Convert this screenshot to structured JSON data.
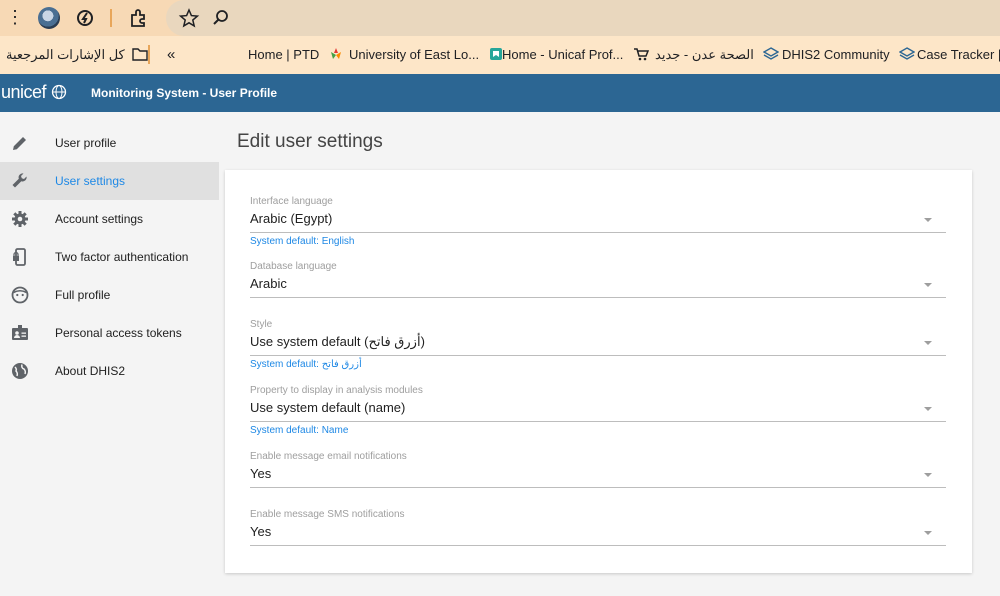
{
  "browser": {
    "bookmarks": [
      {
        "label": "كل الإشارات المرجعية",
        "icon": "folder-icon"
      },
      {
        "label": "Home | PTD",
        "icon": "ptd-icon"
      },
      {
        "label": "University of East Lo...",
        "icon": "university-icon"
      },
      {
        "label": "Home - Unicaf Prof...",
        "icon": "cart-icon"
      },
      {
        "label": "الصحة عدن - جديد",
        "icon": "dhis2-icon"
      },
      {
        "label": "DHIS2 Community",
        "icon": "dhis2-icon"
      },
      {
        "label": "Case Tracker | D",
        "icon": ""
      }
    ],
    "overflow_label": "«"
  },
  "app": {
    "logo": "unicef",
    "title": "Monitoring System - User Profile"
  },
  "sidebar": {
    "items": [
      {
        "label": "User profile",
        "icon": "pencil-icon",
        "active": false
      },
      {
        "label": "User settings",
        "icon": "wrench-icon",
        "active": true
      },
      {
        "label": "Account settings",
        "icon": "gear-icon",
        "active": false
      },
      {
        "label": "Two factor authentication",
        "icon": "phone-lock-icon",
        "active": false
      },
      {
        "label": "Full profile",
        "icon": "face-icon",
        "active": false
      },
      {
        "label": "Personal access tokens",
        "icon": "id-card-icon",
        "active": false
      },
      {
        "label": "About DHIS2",
        "icon": "globe-icon",
        "active": false
      }
    ]
  },
  "main": {
    "title": "Edit user settings",
    "fields": [
      {
        "label": "Interface language",
        "value": "Arabic (Egypt)",
        "help": "System default: English"
      },
      {
        "label": "Database language",
        "value": "Arabic",
        "help": ""
      },
      {
        "label": "Style",
        "value": "Use system default (أزرق فاتح)",
        "help": "System default: أزرق فاتح"
      },
      {
        "label": "Property to display in analysis modules",
        "value": "Use system default (name)",
        "help": "System default: Name"
      },
      {
        "label": "Enable message email notifications",
        "value": "Yes",
        "help": ""
      },
      {
        "label": "Enable message SMS notifications",
        "value": "Yes",
        "help": ""
      }
    ]
  },
  "colors": {
    "appbar": "#2c6693",
    "accent": "#1e88e5",
    "chrome_top": "#f7d9b5",
    "bookmarks_bar": "#fde6c8"
  }
}
